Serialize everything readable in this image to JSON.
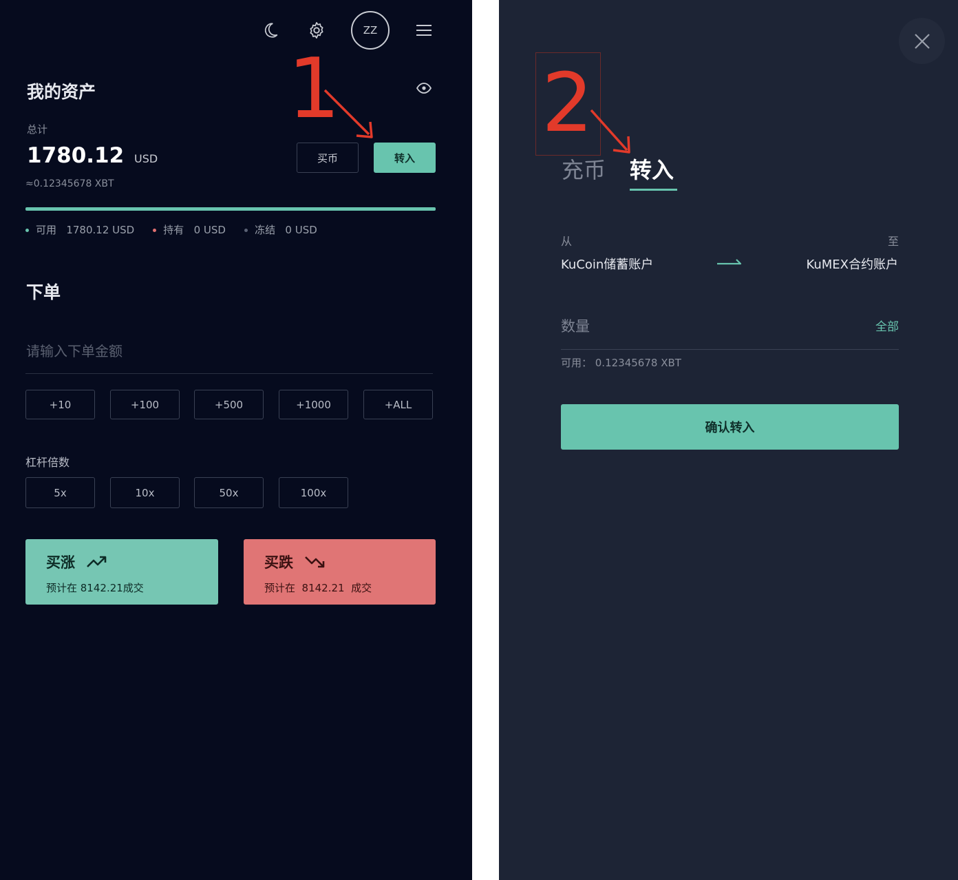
{
  "left": {
    "header": {
      "avatar_initials": "ZZ",
      "icons": [
        "moon-icon",
        "gear-icon",
        "hamburger-menu-icon"
      ]
    },
    "assets": {
      "title": "我的资产",
      "total_label": "总计",
      "total_value": "1780.12",
      "total_unit": "USD",
      "approx": "≈0.12345678 XBT",
      "buy_label": "买币",
      "transfer_label": "转入",
      "legend": [
        {
          "label": "可用",
          "value": "1780.12 USD",
          "color": "#68c4ae"
        },
        {
          "label": "持有",
          "value": "0 USD",
          "color": "#e07070"
        },
        {
          "label": "冻结",
          "value": "0 USD",
          "color": "#5b6275"
        }
      ]
    },
    "order": {
      "title": "下单",
      "amount_placeholder": "请输入下单金额",
      "quick_amounts": [
        "+10",
        "+100",
        "+500",
        "+1000",
        "+ALL"
      ],
      "leverage_label": "杠杆倍数",
      "leverage_options": [
        "5x",
        "10x",
        "50x",
        "100x"
      ],
      "long_label": "买涨",
      "long_sub": "预计在 8142.21成交",
      "short_label": "买跌",
      "short_sub": "预计在  8142.21  成交"
    },
    "annotation_number": "1"
  },
  "right": {
    "tabs": [
      {
        "label": "充币",
        "active": false
      },
      {
        "label": "转入",
        "active": true
      }
    ],
    "from_label": "从",
    "to_label": "至",
    "from_account": "KuCoin储蓄账户",
    "to_account": "KuMEX合约账户",
    "quantity_placeholder": "数量",
    "all_label": "全部",
    "available": "可用： 0.12345678 XBT",
    "confirm_label": "确认转入",
    "annotation_number": "2"
  },
  "colors": {
    "accent_green": "#68c4ae",
    "accent_red": "#e07070",
    "annotation_red": "#e23a2a",
    "left_bg": "#060b1e",
    "right_bg": "#1d2435"
  }
}
